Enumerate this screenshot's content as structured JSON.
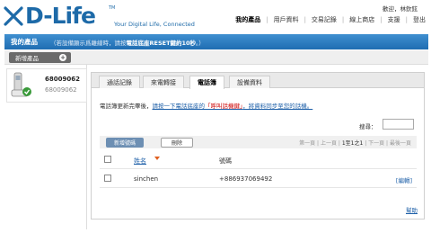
{
  "brand": {
    "logo_text": "D-Life",
    "tagline": "Your Digital Life, Connected",
    "accent": "#1d6aa8"
  },
  "user": {
    "welcome": "歡迎，林欽鉉"
  },
  "topnav": {
    "items": [
      {
        "label": "我的產品",
        "active": true
      },
      {
        "label": "用戶資料"
      },
      {
        "label": "交易記錄"
      },
      {
        "label": "線上商店"
      },
      {
        "label": "支援"
      },
      {
        "label": "登出"
      }
    ]
  },
  "section": {
    "title": "我的產品",
    "hint_prefix": "（若設備顯示爲離線時，請按",
    "hint_bold": "電話底座RESET鍵約10秒",
    "hint_suffix": "。）"
  },
  "add_product": {
    "label": "新增產品",
    "icon": "plus-icon"
  },
  "device": {
    "number": "68009062",
    "number_secondary": "68009062",
    "icon": "phone-icon"
  },
  "tabs": [
    {
      "label": "通話記錄"
    },
    {
      "label": "來電轉接"
    },
    {
      "label": "電話簿",
      "active": true
    },
    {
      "label": "設備資料"
    }
  ],
  "phonebook": {
    "intro_text": "電話簿更新完畢後，",
    "intro_link_a": "請按一下電話底座的",
    "intro_red": "「呼叫話機鍵」",
    "intro_link_b": "，將資料同步至您的話機。",
    "search_label": "搜尋：",
    "search_placeholder": "",
    "add_button": "新增號碼",
    "delete_button": "刪除",
    "pager": {
      "first": "第一頁",
      "prev": "上一頁",
      "current": "1至1之1",
      "next": "下一頁",
      "last": "最後一頁"
    },
    "columns": {
      "name": "姓名",
      "phone": "號碼"
    },
    "rows": [
      {
        "name": "sinchen",
        "phone": "+886937069492",
        "edit": "[編輯]"
      }
    ],
    "help": "幫助"
  }
}
